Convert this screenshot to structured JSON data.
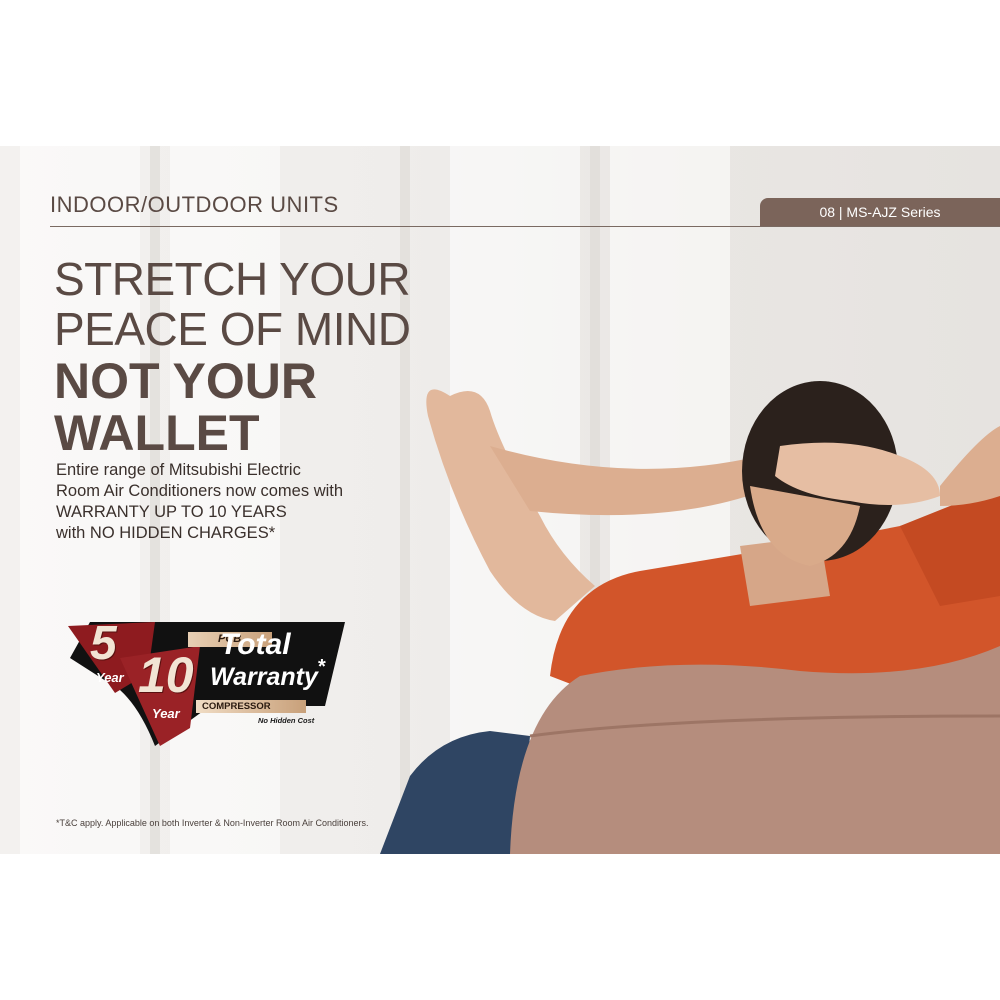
{
  "header": {
    "section_title": "INDOOR/OUTDOOR UNITS",
    "series_tab": "08 | MS-AJZ Series"
  },
  "headline": {
    "line1": "STRETCH YOUR",
    "line2": "PEACE OF MIND",
    "line3": "NOT YOUR",
    "line4": "WALLET"
  },
  "body": {
    "line1": "Entire range of Mitsubishi Electric",
    "line2": "Room Air Conditioners now comes with",
    "line3": "WARRANTY UP TO 10 YEARS",
    "line4": "with NO HIDDEN CHARGES*"
  },
  "badge": {
    "five": "5",
    "year1": "Year",
    "pcb": "PCB",
    "ten": "10",
    "year2": "Year",
    "compressor": "COMPRESSOR",
    "total": "Total",
    "warranty": "Warranty",
    "asterisk": "*",
    "no_hidden": "No Hidden Cost"
  },
  "footnote": "*T&C apply. Applicable on both Inverter & Non-Inverter Room Air Conditioners.",
  "colors": {
    "brand_brown": "#7b645a",
    "heading_brown": "#5a4a44",
    "badge_red": "#8e1b1f",
    "badge_black": "#111111",
    "shirt_orange": "#d2552a",
    "chair": "#b58d7d"
  }
}
